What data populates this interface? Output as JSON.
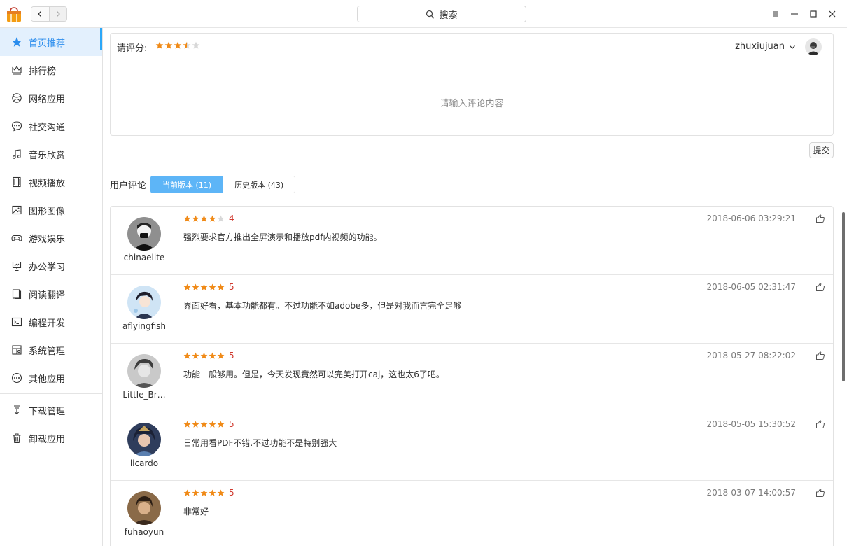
{
  "titlebar": {
    "search_label": "搜索",
    "app_icon": "shopping-bag-icon"
  },
  "sidebar": {
    "items": [
      {
        "label": "首页推荐",
        "icon": "star-icon",
        "active": true
      },
      {
        "label": "排行榜",
        "icon": "crown-icon"
      },
      {
        "label": "网络应用",
        "icon": "globe-icon"
      },
      {
        "label": "社交沟通",
        "icon": "chat-bubble-icon"
      },
      {
        "label": "音乐欣赏",
        "icon": "music-note-icon"
      },
      {
        "label": "视频播放",
        "icon": "film-icon"
      },
      {
        "label": "图形图像",
        "icon": "image-icon"
      },
      {
        "label": "游戏娱乐",
        "icon": "gamepad-icon"
      },
      {
        "label": "办公学习",
        "icon": "presentation-icon"
      },
      {
        "label": "阅读翻译",
        "icon": "book-icon"
      },
      {
        "label": "编程开发",
        "icon": "terminal-icon"
      },
      {
        "label": "系统管理",
        "icon": "system-icon"
      },
      {
        "label": "其他应用",
        "icon": "more-circle-icon"
      }
    ],
    "bottom_items": [
      {
        "label": "下载管理",
        "icon": "download-icon"
      },
      {
        "label": "卸载应用",
        "icon": "trash-icon"
      }
    ]
  },
  "rating": {
    "label": "请评分:",
    "stars_value": 3.5,
    "username": "zhuxiujuan",
    "placeholder": "请输入评论内容",
    "submit_label": "提交"
  },
  "reviews": {
    "label": "用户评论",
    "tabs": [
      {
        "label": "当前版本 (11)",
        "active": true
      },
      {
        "label": "历史版本 (43)",
        "active": false
      }
    ],
    "items": [
      {
        "name": "chinaelite",
        "rating": 4,
        "score": "4",
        "text": "强烈要求官方推出全屏演示和播放pdf内视频的功能。",
        "time": "2018-06-06 03:29:21",
        "avatar_color": "#8a8a8a"
      },
      {
        "name": "aflyingfish",
        "rating": 5,
        "score": "5",
        "text": "界面好看，基本功能都有。不过功能不如adobe多，但是对我而言完全足够",
        "time": "2018-06-05 02:31:47",
        "avatar_color": "#b8d4ee"
      },
      {
        "name": "Little_Br…",
        "rating": 5,
        "score": "5",
        "text": "功能一般够用。但是，今天发现竟然可以完美打开caj，这也太6了吧。",
        "time": "2018-05-27 08:22:02",
        "avatar_color": "#9a9a9a"
      },
      {
        "name": "licardo",
        "rating": 5,
        "score": "5",
        "text": "日常用看PDF不错.不过功能不是特别强大",
        "time": "2018-05-05 15:30:52",
        "avatar_color": "#3a4a6a"
      },
      {
        "name": "fuhaoyun",
        "rating": 5,
        "score": "5",
        "text": "非常好",
        "time": "2018-03-07 14:00:57",
        "avatar_color": "#7a5a3a"
      }
    ]
  },
  "colors": {
    "accent": "#2ca7f8",
    "star": "#f08a17",
    "score": "#d03a2f"
  }
}
